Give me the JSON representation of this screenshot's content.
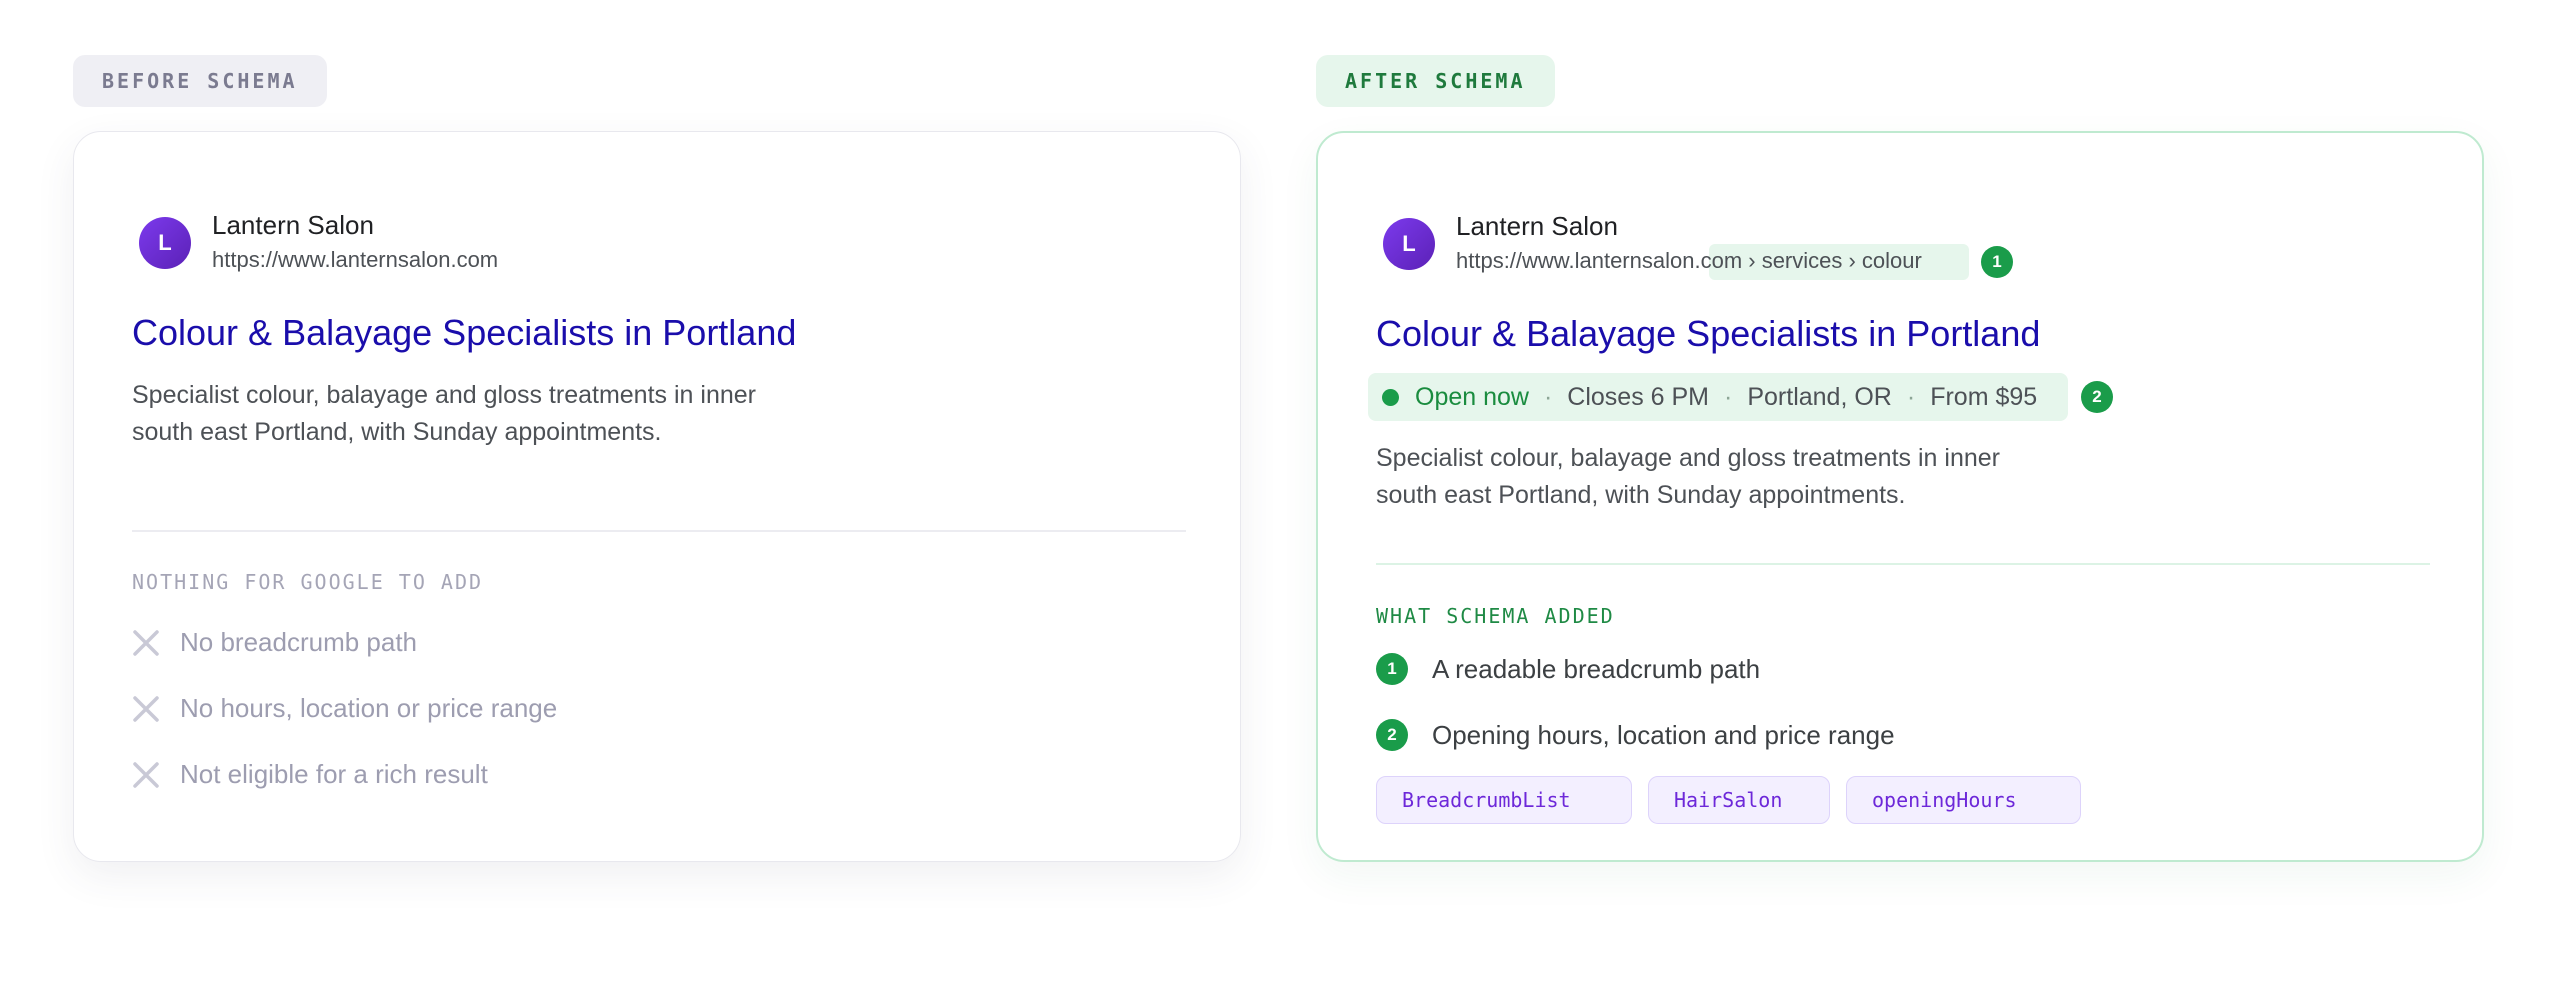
{
  "before": {
    "tag": "BEFORE SCHEMA",
    "result": {
      "avatar_letter": "L",
      "site_name": "Lantern Salon",
      "url": "https://www.lanternsalon.com",
      "title": "Colour & Balayage Specialists in Portland",
      "snippet_line1": "Specialist colour, balayage and gloss treatments in inner",
      "snippet_line2": "south east Portland, with Sunday appointments."
    },
    "section_heading": "NOTHING FOR GOOGLE TO ADD",
    "items": [
      {
        "icon": "x-icon",
        "label": "No breadcrumb path"
      },
      {
        "icon": "x-icon",
        "label": "No hours, location or price range"
      },
      {
        "icon": "x-icon",
        "label": "Not eligible for a rich result"
      }
    ]
  },
  "after": {
    "tag": "AFTER SCHEMA",
    "result": {
      "avatar_letter": "L",
      "site_name": "Lantern Salon",
      "url_base": "https://www.lanternsalon.",
      "url_crumb": "com › services › colour",
      "crumb_marker": "1",
      "title": "Colour & Balayage Specialists in Portland",
      "rich": {
        "status": "Open now",
        "closes": "Closes 6 PM",
        "location": "Portland, OR",
        "price": "From $95",
        "separator": "·",
        "marker": "2"
      },
      "snippet_line1": "Specialist colour, balayage and gloss treatments in inner",
      "snippet_line2": "south east Portland, with Sunday appointments."
    },
    "section_heading": "WHAT SCHEMA ADDED",
    "items": [
      {
        "number": "1",
        "label": "A readable breadcrumb path"
      },
      {
        "number": "2",
        "label": "Opening hours, location and price range"
      }
    ],
    "chips": [
      "BreadcrumbList",
      "HairSalon",
      "openingHours"
    ]
  },
  "colors": {
    "link_title": "#1a0dab",
    "accent_green": "#1a9c4a",
    "avatar_purple": "#6d28d9",
    "chip_text": "#6d28d9"
  }
}
